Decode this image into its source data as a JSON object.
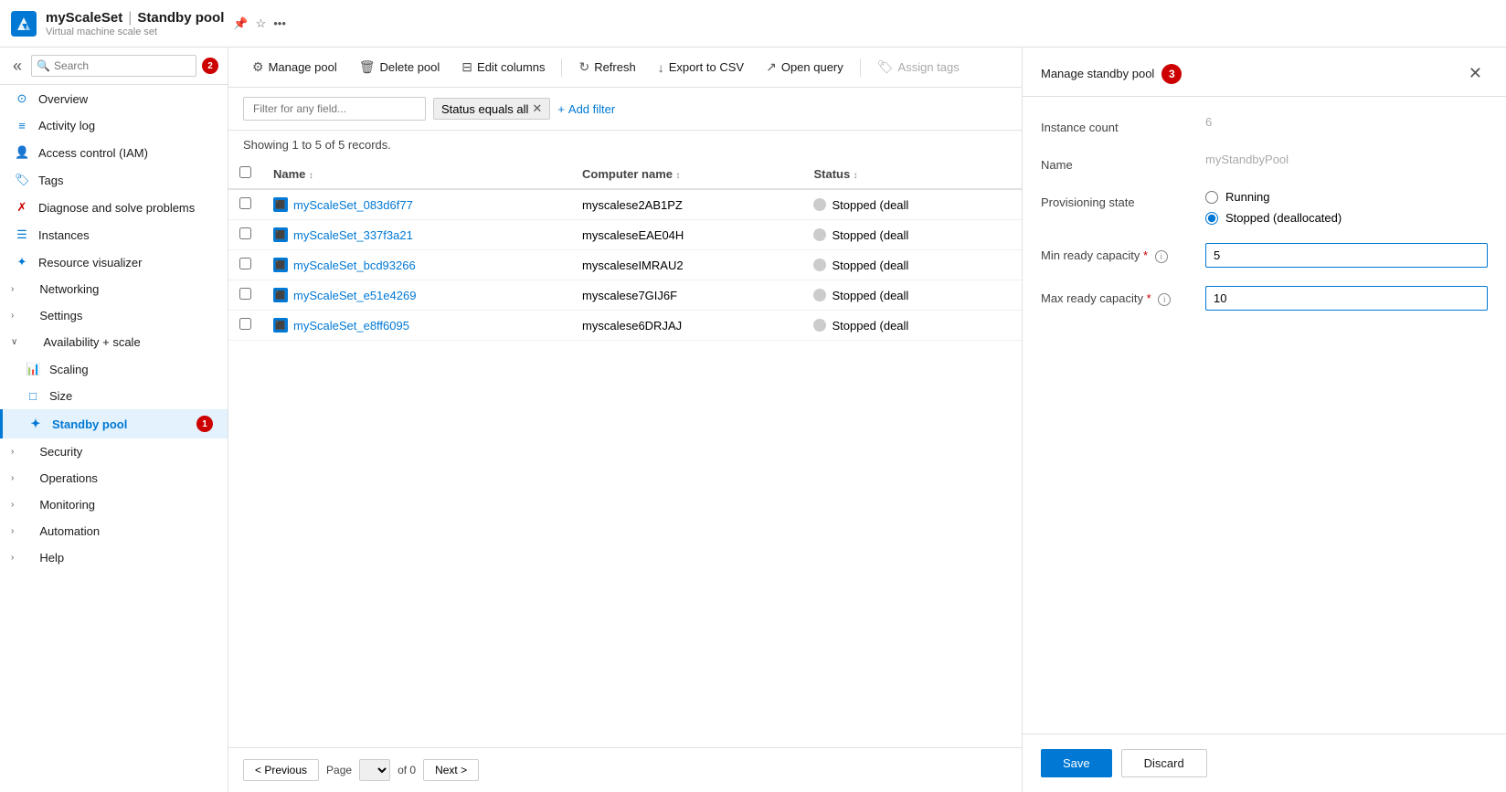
{
  "app": {
    "title": "myScaleSet",
    "separator": "|",
    "section": "Standby pool",
    "subtitle": "Virtual machine scale set"
  },
  "sidebar": {
    "search_placeholder": "Search",
    "collapse_tooltip": "Collapse",
    "nav_badge": "2",
    "items": [
      {
        "id": "overview",
        "label": "Overview",
        "icon": "⊙",
        "indent": false
      },
      {
        "id": "activity-log",
        "label": "Activity log",
        "icon": "≡",
        "indent": false
      },
      {
        "id": "access-control",
        "label": "Access control (IAM)",
        "icon": "👤",
        "indent": false
      },
      {
        "id": "tags",
        "label": "Tags",
        "icon": "🏷",
        "indent": false
      },
      {
        "id": "diagnose",
        "label": "Diagnose and solve problems",
        "icon": "✗",
        "indent": false
      },
      {
        "id": "instances",
        "label": "Instances",
        "icon": "☰",
        "indent": false
      },
      {
        "id": "resource-visualizer",
        "label": "Resource visualizer",
        "icon": "✦",
        "indent": false
      },
      {
        "id": "networking",
        "label": "Networking",
        "icon": "›",
        "indent": false,
        "group": true
      },
      {
        "id": "settings",
        "label": "Settings",
        "icon": "›",
        "indent": false,
        "group": true
      },
      {
        "id": "availability-scale",
        "label": "Availability + scale",
        "icon": "∨",
        "indent": false,
        "group": true,
        "expanded": true
      },
      {
        "id": "scaling",
        "label": "Scaling",
        "icon": "📊",
        "indent": true
      },
      {
        "id": "size",
        "label": "Size",
        "icon": "□",
        "indent": true
      },
      {
        "id": "standby-pool",
        "label": "Standby pool",
        "icon": "✦",
        "indent": true,
        "active": true,
        "badge": "1"
      },
      {
        "id": "security",
        "label": "Security",
        "icon": "›",
        "indent": false,
        "group": true
      },
      {
        "id": "operations",
        "label": "Operations",
        "icon": "›",
        "indent": false,
        "group": true
      },
      {
        "id": "monitoring",
        "label": "Monitoring",
        "icon": "›",
        "indent": false,
        "group": true
      },
      {
        "id": "automation",
        "label": "Automation",
        "icon": "›",
        "indent": false,
        "group": true
      },
      {
        "id": "help",
        "label": "Help",
        "icon": "›",
        "indent": false,
        "group": true
      }
    ]
  },
  "toolbar": {
    "manage_pool": "Manage pool",
    "delete_pool": "Delete pool",
    "edit_columns": "Edit columns",
    "refresh": "Refresh",
    "export_csv": "Export to CSV",
    "open_query": "Open query",
    "assign_tags": "Assign tags"
  },
  "filter": {
    "placeholder": "Filter for any field...",
    "active_filter": "Status equals all",
    "add_filter": "Add filter"
  },
  "table": {
    "records_text": "Showing 1 to 5 of 5 records.",
    "columns": [
      "Name",
      "Computer name",
      "Status"
    ],
    "rows": [
      {
        "name": "myScaleSet_083d6f77",
        "computer": "myscalese2AB1PZ",
        "status": "Stopped (deall"
      },
      {
        "name": "myScaleSet_337f3a21",
        "computer": "myscaleseEAE04H",
        "status": "Stopped (deall"
      },
      {
        "name": "myScaleSet_bcd93266",
        "computer": "myscaleseIMRAU2",
        "status": "Stopped (deall"
      },
      {
        "name": "myScaleSet_e51e4269",
        "computer": "myscalese7GIJ6F",
        "status": "Stopped (deall"
      },
      {
        "name": "myScaleSet_e8ff6095",
        "computer": "myscalese6DRJAJ",
        "status": "Stopped (deall"
      }
    ]
  },
  "pagination": {
    "previous": "< Previous",
    "next": "Next >",
    "page_label": "Page",
    "of_label": "of 0"
  },
  "side_panel": {
    "title": "Manage standby pool",
    "badge": "3",
    "fields": {
      "instance_count_label": "Instance count",
      "instance_count_value": "6",
      "name_label": "Name",
      "name_value": "myStandbyPool",
      "provisioning_state_label": "Provisioning state",
      "radio_running": "Running",
      "radio_stopped": "Stopped (deallocated)",
      "min_ready_label": "Min ready capacity",
      "min_ready_value": "5",
      "max_ready_label": "Max ready capacity",
      "max_ready_value": "10"
    },
    "save_label": "Save",
    "discard_label": "Discard"
  }
}
